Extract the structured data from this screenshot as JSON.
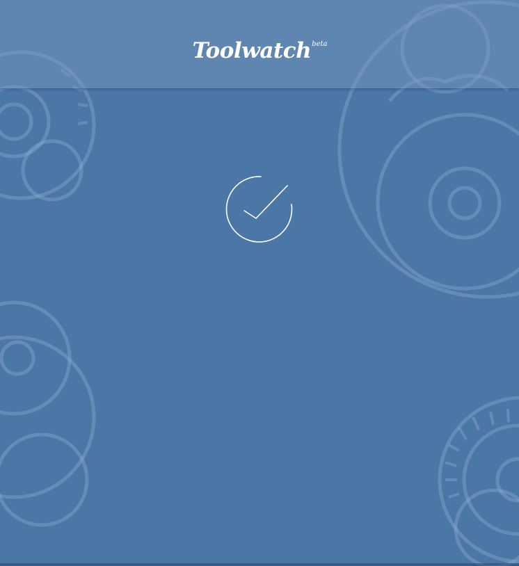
{
  "app": {
    "name": "Toolwatch",
    "superscript": "beta"
  },
  "status": {
    "icon": "checkmark-circle-icon"
  },
  "decorations": {
    "background_icon": "watch-gears-icon"
  },
  "colors": {
    "background": "#4b77a7",
    "header": "#6a8fbb",
    "foreground": "#ffffff"
  }
}
